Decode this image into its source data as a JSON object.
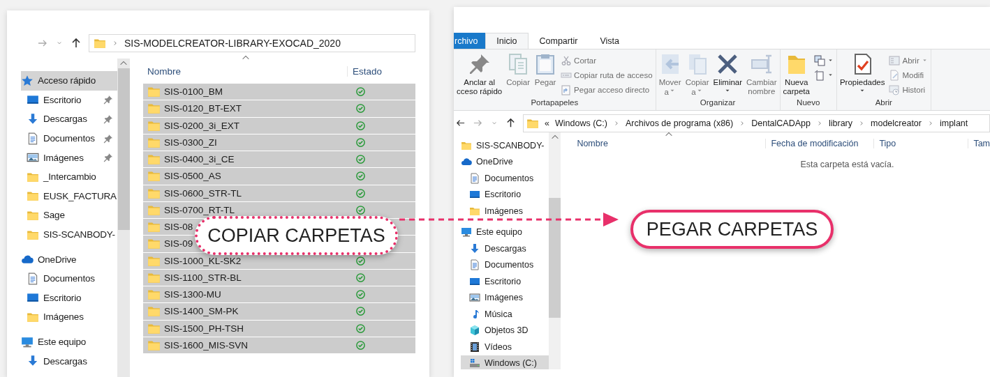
{
  "copy_window": {
    "address": {
      "path": "SIS-MODELCREATOR-LIBRARY-EXOCAD_2020"
    },
    "nav_pane": [
      {
        "label": "Acceso rápido",
        "kind": "quick-access",
        "selected": true,
        "children": [
          {
            "label": "Escritorio",
            "kind": "desktop",
            "pinned": true,
            "selected": false
          },
          {
            "label": "Descargas",
            "kind": "downloads",
            "pinned": true,
            "selected": false
          },
          {
            "label": "Documentos",
            "kind": "documents",
            "pinned": true,
            "selected": false
          },
          {
            "label": "Imágenes",
            "kind": "pictures",
            "pinned": true,
            "selected": false
          },
          {
            "label": "_Intercambio",
            "kind": "folder",
            "pinned": false,
            "selected": false
          },
          {
            "label": "EUSK_FACTURA",
            "kind": "folder",
            "pinned": false,
            "selected": false
          },
          {
            "label": "Sage",
            "kind": "folder",
            "pinned": false,
            "selected": false
          },
          {
            "label": "SIS-SCANBODY-",
            "kind": "folder",
            "pinned": false,
            "selected": false
          }
        ]
      },
      {
        "label": "OneDrive",
        "kind": "onedrive",
        "selected": false,
        "children": [
          {
            "label": "Documentos",
            "kind": "documents",
            "pinned": false,
            "selected": false
          },
          {
            "label": "Escritorio",
            "kind": "desktop",
            "pinned": false,
            "selected": false
          },
          {
            "label": "Imágenes",
            "kind": "folder",
            "pinned": false,
            "selected": false
          }
        ]
      },
      {
        "label": "Este equipo",
        "kind": "pc",
        "selected": false,
        "children": [
          {
            "label": "Descargas",
            "kind": "downloads",
            "pinned": false,
            "selected": false
          }
        ]
      }
    ],
    "columns": [
      "Nombre",
      "Estado"
    ],
    "files": [
      {
        "name": "SIS-0100_BM",
        "selected": true
      },
      {
        "name": "SIS-0120_BT-EXT",
        "selected": true
      },
      {
        "name": "SIS-0200_3i_EXT",
        "selected": true
      },
      {
        "name": "SIS-0300_ZI",
        "selected": true
      },
      {
        "name": "SIS-0400_3i_CE",
        "selected": true
      },
      {
        "name": "SIS-0500_AS",
        "selected": true
      },
      {
        "name": "SIS-0600_STR-TL",
        "selected": true
      },
      {
        "name": "SIS-0700_RT-TL",
        "selected": true
      },
      {
        "name": "SIS-08",
        "selected": true
      },
      {
        "name": "SIS-09",
        "selected": true
      },
      {
        "name": "SIS-1000_KL-SK2",
        "selected": true
      },
      {
        "name": "SIS-1100_STR-BL",
        "selected": true
      },
      {
        "name": "SIS-1300-MU",
        "selected": true
      },
      {
        "name": "SIS-1400_SM-PK",
        "selected": true
      },
      {
        "name": "SIS-1500_PH-TSH",
        "selected": true
      },
      {
        "name": "SIS-1600_MIS-SVN",
        "selected": true
      }
    ]
  },
  "paste_window": {
    "tabs": [
      {
        "label": "rchivo",
        "kind": "file",
        "selected": false
      },
      {
        "label": "Inicio",
        "kind": "tab",
        "selected": true
      },
      {
        "label": "Compartir",
        "kind": "tab",
        "selected": false
      },
      {
        "label": "Vista",
        "kind": "tab",
        "selected": false
      }
    ],
    "ribbon": [
      {
        "label": "Portapapeles",
        "items": [
          {
            "kind": "large",
            "lines": [
              "Anclar al",
              "cceso rápido"
            ],
            "disabled": false
          },
          {
            "kind": "large",
            "lines": [
              "Copiar"
            ],
            "disabled": true
          },
          {
            "kind": "large",
            "lines": [
              "Pegar"
            ],
            "disabled": true
          },
          {
            "kind": "small",
            "label": "Cortar",
            "disabled": true
          },
          {
            "kind": "small",
            "label": "Copiar ruta de acceso",
            "disabled": true
          },
          {
            "kind": "small",
            "label": "Pegar acceso directo",
            "disabled": true
          }
        ]
      },
      {
        "label": "Organizar",
        "items": [
          {
            "kind": "large",
            "lines": [
              "Mover",
              "a"
            ],
            "dropdown": true,
            "disabled": true
          },
          {
            "kind": "large",
            "lines": [
              "Copiar",
              "a"
            ],
            "dropdown": true,
            "disabled": true
          },
          {
            "kind": "large",
            "lines": [
              "Eliminar"
            ],
            "dropdown": true,
            "disabled": false
          },
          {
            "kind": "large",
            "lines": [
              "Cambiar",
              "nombre"
            ],
            "disabled": true
          }
        ]
      },
      {
        "label": "Nuevo",
        "items": [
          {
            "kind": "large",
            "lines": [
              "Nueva",
              "carpeta"
            ],
            "disabled": false
          },
          {
            "kind": "small",
            "dropdown": true,
            "disabled": false
          },
          {
            "kind": "small",
            "dropdown": true,
            "disabled": false
          }
        ]
      },
      {
        "label": "Abrir",
        "items": [
          {
            "kind": "large",
            "lines": [
              "Propiedades"
            ],
            "dropdown": true,
            "disabled": false
          },
          {
            "kind": "small",
            "label": "Abrir",
            "dropdown": true,
            "disabled": true
          },
          {
            "kind": "small",
            "label": "Modifi",
            "disabled": true
          },
          {
            "kind": "small",
            "label": "Histori",
            "disabled": true
          }
        ]
      }
    ],
    "address": {
      "overflow": "«",
      "segments": [
        "Windows (C:)",
        "Archivos de programa (x86)",
        "DentalCADApp",
        "library",
        "modelcreator",
        "implant"
      ]
    },
    "nav_pane": [
      {
        "label": "SIS-SCANBODY-",
        "kind": "folder",
        "selected": false
      },
      {
        "label": "OneDrive",
        "kind": "onedrive",
        "selected": false,
        "children": [
          {
            "label": "Documentos",
            "kind": "documents",
            "selected": false
          },
          {
            "label": "Escritorio",
            "kind": "desktop",
            "selected": false
          },
          {
            "label": "Imágenes",
            "kind": "folder",
            "selected": false
          }
        ]
      },
      {
        "label": "Este equipo",
        "kind": "pc",
        "selected": false,
        "children": [
          {
            "label": "Descargas",
            "kind": "downloads",
            "selected": false
          },
          {
            "label": "Documentos",
            "kind": "documents",
            "selected": false
          },
          {
            "label": "Escritorio",
            "kind": "desktop",
            "selected": false
          },
          {
            "label": "Imágenes",
            "kind": "pictures",
            "selected": false
          },
          {
            "label": "Música",
            "kind": "music",
            "selected": false
          },
          {
            "label": "Objetos 3D",
            "kind": "objects3d",
            "selected": false
          },
          {
            "label": "Vídeos",
            "kind": "videos",
            "selected": false
          },
          {
            "label": "Windows (C:)",
            "kind": "drive",
            "selected": true
          }
        ]
      }
    ],
    "columns": [
      "Nombre",
      "Fecha de modificación",
      "Tipo",
      "Tam"
    ],
    "empty_message": "Esta carpeta está vacía."
  },
  "callouts": [
    {
      "text": "COPIAR CARPETAS",
      "kind": "dotted"
    },
    {
      "text": "PEGAR CARPETAS",
      "kind": "solid"
    }
  ]
}
